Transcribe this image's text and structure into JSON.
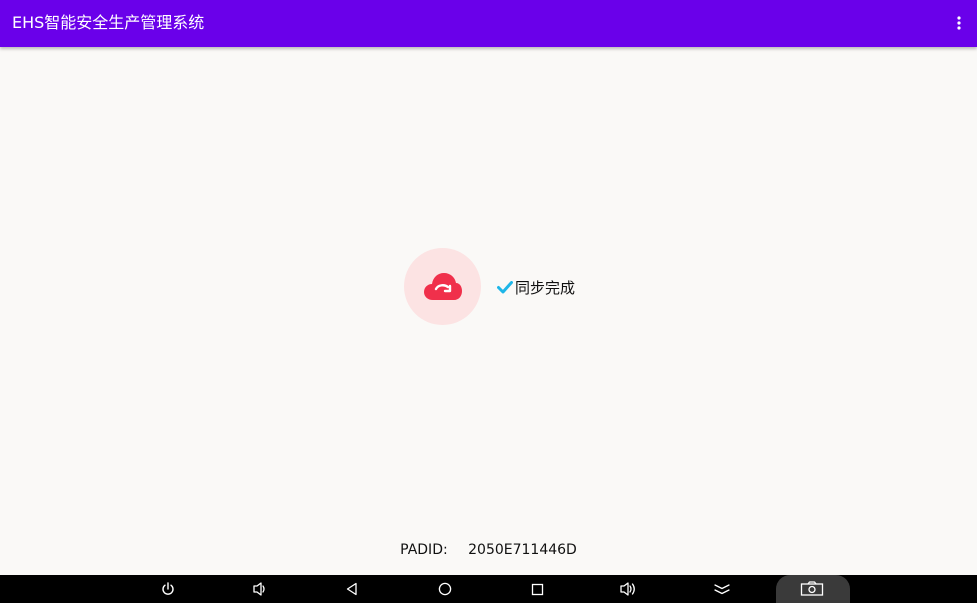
{
  "app_bar": {
    "title": "EHS智能安全生产管理系统",
    "background": "#6A00EA"
  },
  "sync": {
    "status_text": "同步完成",
    "cloud_color": "#F0304B",
    "check_color": "#1EB6E8"
  },
  "device": {
    "padid_label": "PADID:",
    "padid_value": "2050E711446D"
  },
  "nav_bar": {
    "buttons": [
      "power-icon",
      "volume-down-icon",
      "back-icon",
      "home-icon",
      "recents-icon",
      "volume-up-icon",
      "collapse-icon",
      "screenshot-icon"
    ]
  }
}
